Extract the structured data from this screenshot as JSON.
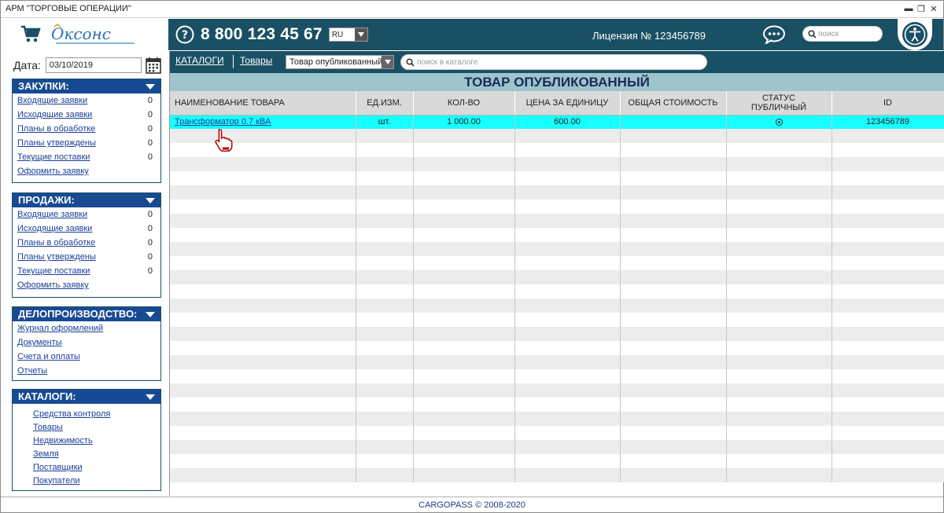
{
  "window": {
    "title": "АРМ \"ТОРГОВЫЕ ОПЕРАЦИИ\""
  },
  "header": {
    "phone": "8 800 123 45 67",
    "lang": "RU",
    "license": "Лицензия № 123456789",
    "search_placeholder": "поиск",
    "logo_text": "Оксонс"
  },
  "sidebar": {
    "date_label": "Дата:",
    "date_value": "03/10/2019",
    "purchases": {
      "title": "ЗАКУПКИ:",
      "items": [
        {
          "label": "Входящие заявки",
          "count": "0"
        },
        {
          "label": "Исходящие заявки",
          "count": "0"
        },
        {
          "label": "Планы в обработке",
          "count": "0"
        },
        {
          "label": "Планы утверждены",
          "count": "0"
        },
        {
          "label": "Текущие поставки",
          "count": "0"
        },
        {
          "label": "Оформить заявку",
          "count": ""
        }
      ]
    },
    "sales": {
      "title": "ПРОДАЖИ:",
      "items": [
        {
          "label": "Входящие заявки",
          "count": "0"
        },
        {
          "label": "Исходящие заявки",
          "count": "0"
        },
        {
          "label": "Планы в обработке",
          "count": "0"
        },
        {
          "label": "Планы утверждены",
          "count": "0"
        },
        {
          "label": "Текущие поставки",
          "count": "0"
        },
        {
          "label": "Оформить заявку",
          "count": ""
        }
      ]
    },
    "records": {
      "title": "ДЕЛОПРОИЗВОДСТВО:",
      "items": [
        "Журнал оформлений",
        "Документы",
        "Счета и оплаты",
        "Отчеты"
      ]
    },
    "catalogs": {
      "title": "КАТАЛОГИ:",
      "items": [
        "Средства контроля",
        "Товары",
        "Недвижимость",
        "Земля",
        "Поставщики",
        "Покупатели"
      ]
    }
  },
  "main": {
    "tab_catalogs": "КАТАЛОГИ",
    "tab_goods": "Товары",
    "filter_value": "Товар опубликованный",
    "search_placeholder": "поиск в каталоге",
    "page_title": "ТОВАР ОПУБЛИКОВАННЫЙ",
    "columns": [
      "НАИМЕНОВАНИЕ ТОВАРА",
      "ЕД.ИЗМ.",
      "КОЛ-ВО",
      "ЦЕНА ЗА ЕДИНИЦУ",
      "ОБЩАЯ СТОИМОСТЬ",
      "СТАТУС ПУБЛИЧНЫЙ",
      "ID"
    ],
    "rows": [
      {
        "name": "Трансформатор 0.7 кВА",
        "unit": "шт.",
        "qty": "1 000.00",
        "price": "600.00",
        "total": "",
        "status": "selected",
        "id": "123456789"
      }
    ]
  },
  "footer": {
    "text": "CARGOPASS © 2008-2020"
  },
  "colors": {
    "header_bg": "#1a5063",
    "panel_head": "#174a93",
    "highlight_row": "#17ffff",
    "title_band": "#9fc5cc"
  }
}
